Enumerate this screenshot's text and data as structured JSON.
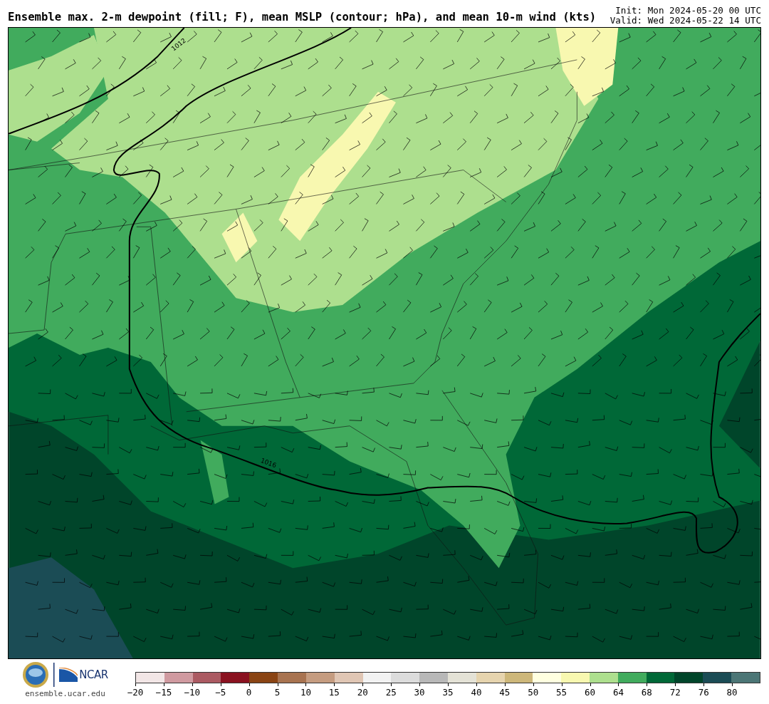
{
  "header": {
    "title": "Ensemble max. 2-m dewpoint (fill; F), mean MSLP (contour; hPa), and mean 10-m wind (kts)",
    "init": "Init: Mon 2024-05-20 00 UTC",
    "valid": "Valid: Wed 2024-05-22 14 UTC"
  },
  "map": {
    "contour_labels": [
      {
        "text": "1012"
      },
      {
        "text": "1016"
      }
    ]
  },
  "footer": {
    "logo_text": "NCAR",
    "url": "ensemble.ucar.edu"
  },
  "colorbar": {
    "segments": [
      {
        "color": "#f2e6e6"
      },
      {
        "color": "#d09aa0"
      },
      {
        "color": "#ab5a62"
      },
      {
        "color": "#8a1220"
      },
      {
        "color": "#8a4414"
      },
      {
        "color": "#a87350"
      },
      {
        "color": "#c59c80"
      },
      {
        "color": "#e0c6b4"
      },
      {
        "color": "#f2f2f2"
      },
      {
        "color": "#dcdcdc"
      },
      {
        "color": "#b8b8b8"
      },
      {
        "color": "#e4e2d6"
      },
      {
        "color": "#e6d4ae"
      },
      {
        "color": "#cdb77a"
      },
      {
        "color": "#ffffe0"
      },
      {
        "color": "#f8f8b0"
      },
      {
        "color": "#addf8e"
      },
      {
        "color": "#41ab5d"
      },
      {
        "color": "#006837"
      },
      {
        "color": "#00452a"
      },
      {
        "color": "#1b4c55"
      },
      {
        "color": "#4c7676"
      }
    ],
    "ticks": [
      "−20",
      "−15",
      "−10",
      "−5",
      "0",
      "5",
      "10",
      "15",
      "20",
      "25",
      "30",
      "35",
      "40",
      "45",
      "50",
      "55",
      "60",
      "64",
      "68",
      "72",
      "76",
      "80"
    ]
  }
}
